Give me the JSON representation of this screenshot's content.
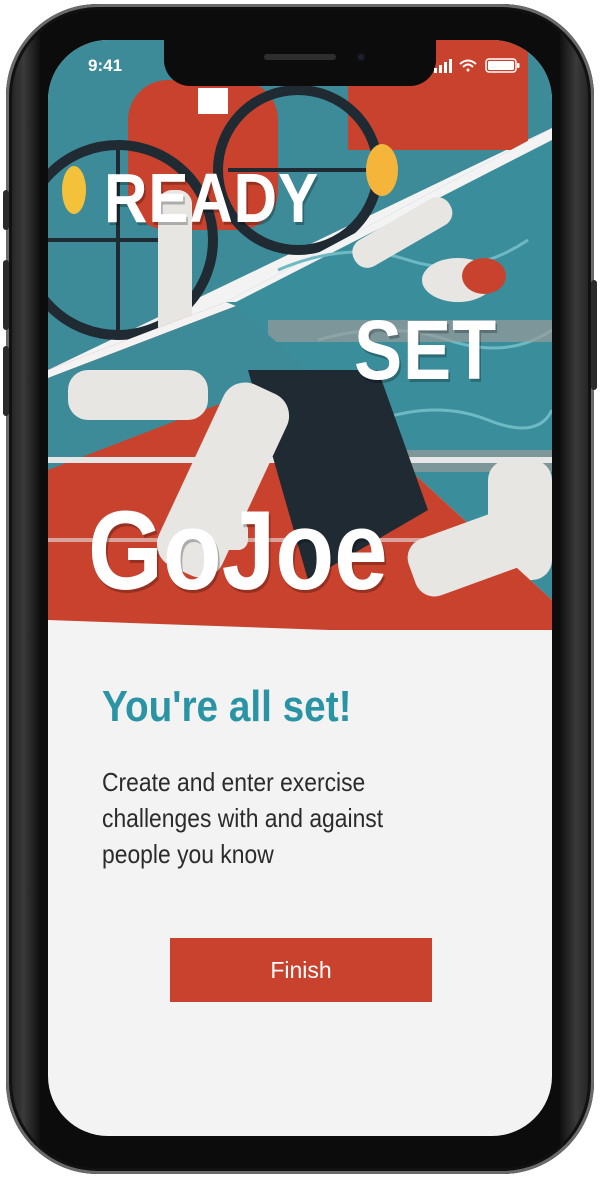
{
  "status_bar": {
    "time": "9:41"
  },
  "hero": {
    "word_ready": "READY",
    "word_set": "SET",
    "word_brand": "GoJoe"
  },
  "content": {
    "headline": "You're all set!",
    "description": "Create and enter exercise challenges with and against people you know"
  },
  "actions": {
    "finish_label": "Finish"
  },
  "colors": {
    "accent_teal": "#2a94a5",
    "accent_red": "#c8422e",
    "background": "#f3f3f3"
  },
  "icons": [
    "signal-icon",
    "wifi-icon",
    "battery-icon"
  ]
}
